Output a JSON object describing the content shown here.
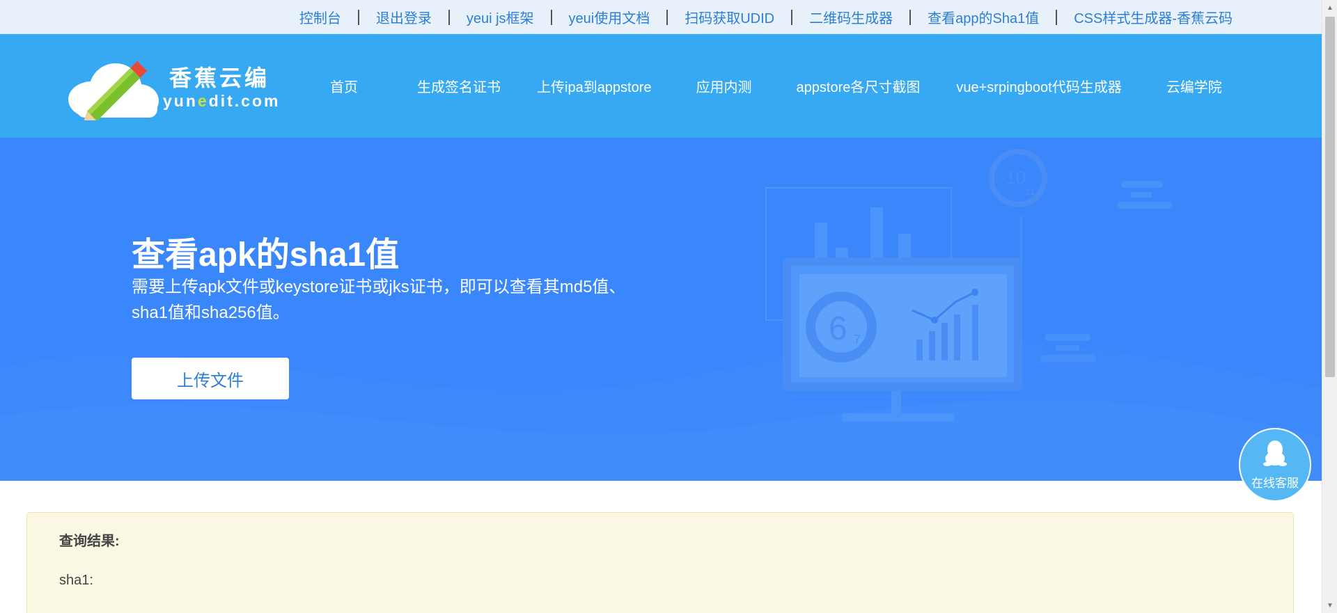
{
  "topbar": {
    "links": [
      "控制台",
      "退出登录",
      "yeui js框架",
      "yeui使用文档",
      "扫码获取UDID",
      "二维码生成器",
      "查看app的Sha1值",
      "CSS样式生成器-香蕉云码"
    ]
  },
  "header": {
    "logo_cn": "香蕉云编",
    "logo_en_prefix": "yun",
    "logo_en_highlight": "e",
    "logo_en_suffix": "dit.com",
    "nav": [
      "首页",
      "生成签名证书",
      "上传ipa到appstore",
      "应用内测",
      "appstore各尺寸截图",
      "vue+srpingboot代码生成器",
      "云编学院"
    ]
  },
  "hero": {
    "title": "查看apk的sha1值",
    "description": "需要上传apk文件或keystore证书或jks证书，即可以查看其md5值、sha1值和sha256值。",
    "upload_label": "上传文件",
    "illus_num_large": "6",
    "illus_num_large_sub": "7",
    "illus_num_top": "10",
    "illus_num_top_sub": "11"
  },
  "result": {
    "label": "查询结果:",
    "sha1_label": "sha1:"
  },
  "chat": {
    "label": "在线客服"
  },
  "colors": {
    "topbar_bg": "#e8f1f9",
    "topbar_link": "#2b7fd6",
    "nav_bg": "#37a9f3",
    "hero_bg": "#3a86fb",
    "result_bg": "#faf8e3",
    "chat_bg": "#55b8f5"
  }
}
